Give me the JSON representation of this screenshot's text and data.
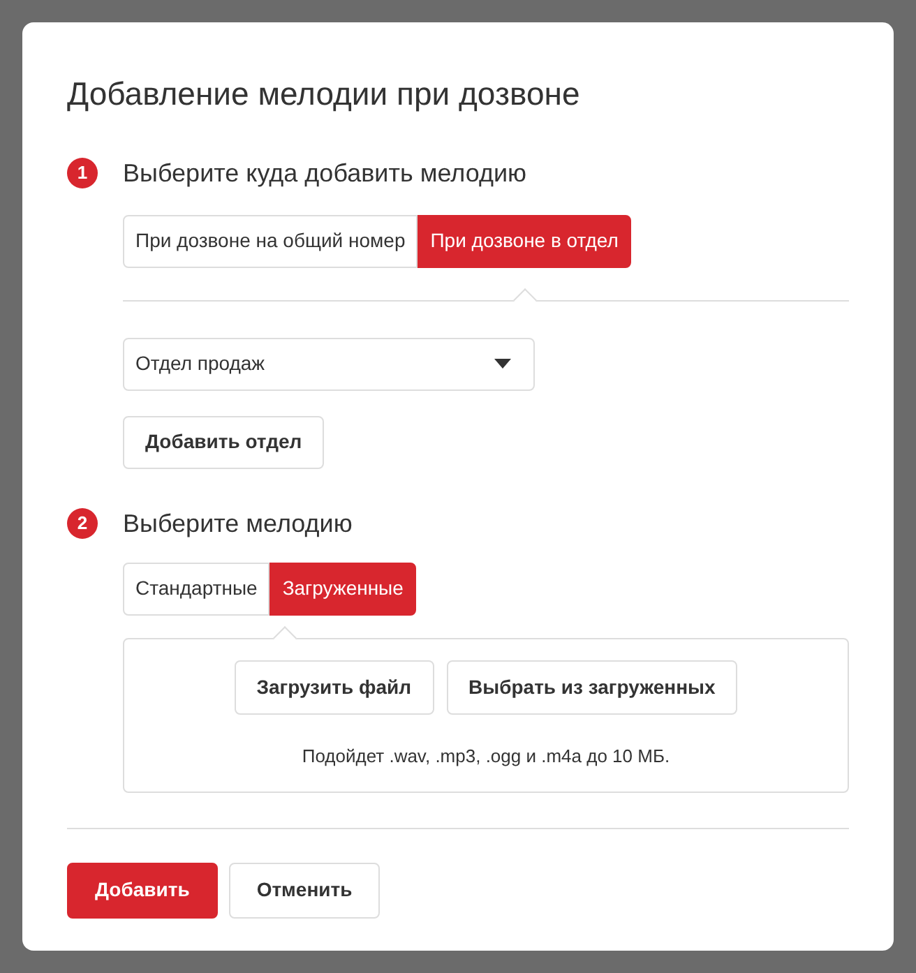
{
  "dialog": {
    "title": "Добавление мелодии при дозвоне"
  },
  "step1": {
    "number": "1",
    "title": "Выберите куда добавить мелодию",
    "tabs": [
      {
        "label": "При дозвоне на общий номер",
        "selected": false
      },
      {
        "label": "При дозвоне в отдел",
        "selected": true
      }
    ],
    "department_select": {
      "value": "Отдел продаж"
    },
    "add_department_button": "Добавить отдел"
  },
  "step2": {
    "number": "2",
    "title": "Выберите мелодию",
    "tabs": [
      {
        "label": "Стандартные",
        "selected": false
      },
      {
        "label": "Загруженные",
        "selected": true
      }
    ],
    "buttons": [
      "Загрузить файл",
      "Выбрать из загруженных"
    ],
    "hint": "Подойдет .wav, .mp3, .ogg и .m4a до 10 МБ."
  },
  "footer": {
    "buttons": [
      {
        "label": "Добавить",
        "kind": "primary"
      },
      {
        "label": "Отменить",
        "kind": "secondary"
      }
    ]
  }
}
